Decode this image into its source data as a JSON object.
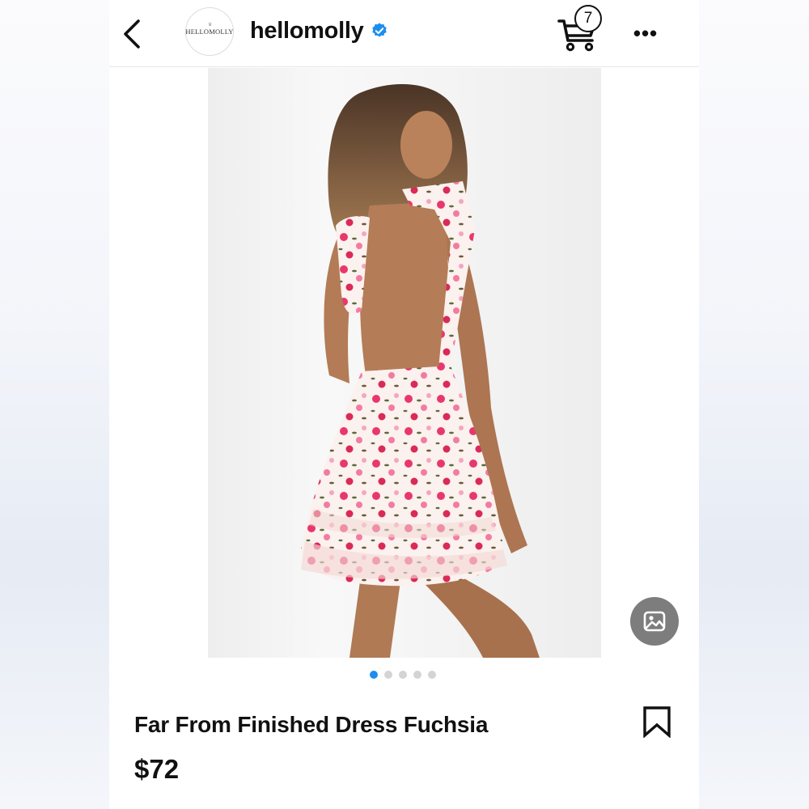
{
  "header": {
    "username": "hellomolly",
    "avatar_text": "HELLOMOLLY",
    "cart_count": "7",
    "more_label": "•••"
  },
  "product": {
    "title": "Far From Finished Dress Fuchsia",
    "price": "$72",
    "image_count": 5,
    "active_image_index": 0
  },
  "colors": {
    "verified": "#1d8ef0",
    "active_dot": "#1d8ef0",
    "inactive_dot": "#d4d4d4",
    "gallery_button": "#7d7d7d"
  },
  "icons": {
    "back": "chevron-left-icon",
    "verified": "verified-badge-icon",
    "cart": "shopping-cart-icon",
    "more": "more-horizontal-icon",
    "gallery": "image-icon",
    "bookmark": "bookmark-icon"
  }
}
